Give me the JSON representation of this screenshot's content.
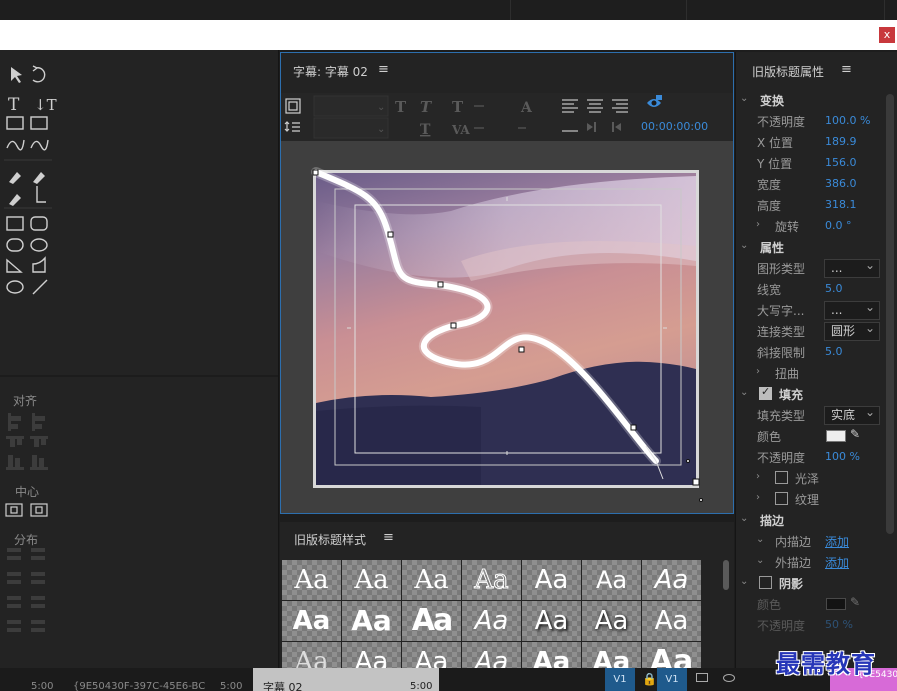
{
  "window": {
    "close_label": "x"
  },
  "left_tools": {
    "align_label": "对齐",
    "center_label": "中心",
    "distribute_label": "分布"
  },
  "title_panel": {
    "tab_label": "字幕: 字幕 02",
    "menu_icon": "≡",
    "timecode": "00:00:00:00"
  },
  "style_panel": {
    "tab_label": "旧版标题样式",
    "menu_icon": "≡",
    "sample_text": "Aa"
  },
  "properties": {
    "tab_label": "旧版标题属性",
    "menu_icon": "≡",
    "transform": {
      "label": "变换",
      "opacity_label": "不透明度",
      "opacity": "100.0 %",
      "x_label": "X 位置",
      "x": "189.9",
      "y_label": "Y 位置",
      "y": "156.0",
      "width_label": "宽度",
      "width": "386.0",
      "height_label": "高度",
      "height": "318.1",
      "rotation_label": "旋转",
      "rotation": "0.0 °"
    },
    "attributes": {
      "label": "属性",
      "shape_type_label": "图形类型",
      "shape_type": "...",
      "line_width_label": "线宽",
      "line_width": "5.0",
      "caps_label": "大写字...",
      "caps": "...",
      "join_type_label": "连接类型",
      "join_type": "圆形",
      "miter_limit_label": "斜接限制",
      "miter_limit": "5.0",
      "distort_label": "扭曲"
    },
    "fill": {
      "label": "填充",
      "checked": true,
      "fill_type_label": "填充类型",
      "fill_type": "实底",
      "color_label": "颜色",
      "color": "#eeeeee",
      "opacity_label": "不透明度",
      "opacity": "100 %",
      "sheen_label": "光泽",
      "texture_label": "纹理"
    },
    "stroke": {
      "label": "描边",
      "inner_label": "内描边",
      "inner_action": "添加",
      "outer_label": "外描边",
      "outer_action": "添加"
    },
    "shadow": {
      "label": "阴影",
      "color_label": "颜色",
      "color": "#000000",
      "opacity_label": "不透明度",
      "opacity": "50 %"
    }
  },
  "timeline": {
    "time_a": "5:00",
    "clip_id": "{9E50430F-397C-45E6-BC",
    "time_b": "5:00",
    "clip_name": "字幕 02",
    "time_c": "5:00",
    "v1_a": "V1",
    "v1_b": "V1",
    "right_clip": "{9E5430"
  },
  "watermark": "最需教育",
  "colors": {
    "accent": "#3a8ad8",
    "panel_border": "#2d6fae",
    "close": "#c8383c"
  }
}
